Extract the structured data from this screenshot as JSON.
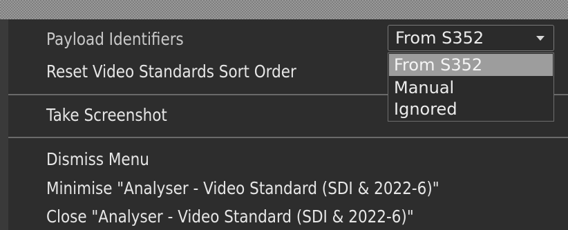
{
  "menu": {
    "payload_label": "Payload Identifiers",
    "reset_sort": "Reset Video Standards Sort Order",
    "take_screenshot": "Take Screenshot",
    "dismiss": "Dismiss Menu",
    "minimise": "Minimise \"Analyser - Video Standard (SDI & 2022-6)\"",
    "close": "Close \"Analyser - Video Standard (SDI & 2022-6)\""
  },
  "payload_select": {
    "value": "From S352",
    "options": [
      "From S352",
      "Manual",
      "Ignored"
    ],
    "selected_index": 0
  }
}
